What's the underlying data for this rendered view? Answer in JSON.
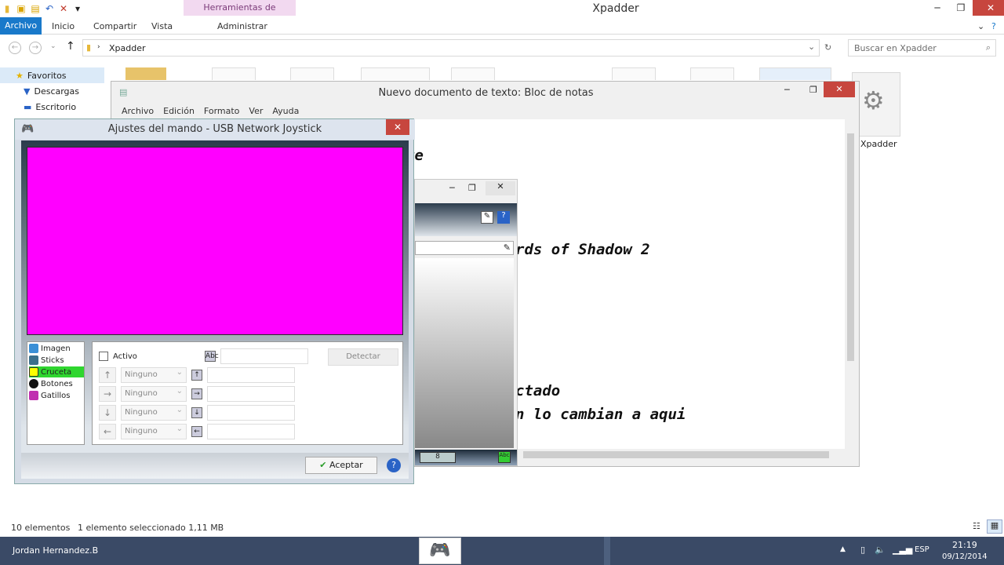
{
  "explorer": {
    "context_tab": "Herramientas de aplicación",
    "title": "Xpadder",
    "tabs": [
      "Archivo",
      "Inicio",
      "Compartir",
      "Vista",
      "Administrar"
    ],
    "path": "Xpadder",
    "search_placeholder": "Buscar en Xpadder",
    "nav": [
      "Favoritos",
      "Descargas",
      "Escritorio"
    ],
    "selected_icon_label": "Xpadder",
    "status_items": "10 elementos",
    "status_selection": "1 elemento seleccionado  1,11 MB"
  },
  "notepad": {
    "title": "Nuevo documento de texto: Bloc de notas",
    "menu": [
      "Archivo",
      "Edición",
      "Formato",
      "Ver",
      "Ayuda"
    ],
    "lines": [
      "re",
      "rds of Shadow 2",
      "ctado",
      "n lo cambian a aqui"
    ]
  },
  "dialog": {
    "title": "Ajustes del mando - USB Network Joystick",
    "canvas_color": "#ff00ff",
    "list": [
      "Imagen",
      "Sticks",
      "Cruceta",
      "Botones",
      "Gatillos"
    ],
    "activo_label": "Activo",
    "detect_label": "Detectar",
    "dropdown_value": "Ninguno",
    "accept_label": "Aceptar",
    "counter": "8"
  },
  "taskbar": {
    "user": "Jordan Hernandez.B",
    "lang": "ESP",
    "time": "21:19",
    "date": "09/12/2014"
  }
}
